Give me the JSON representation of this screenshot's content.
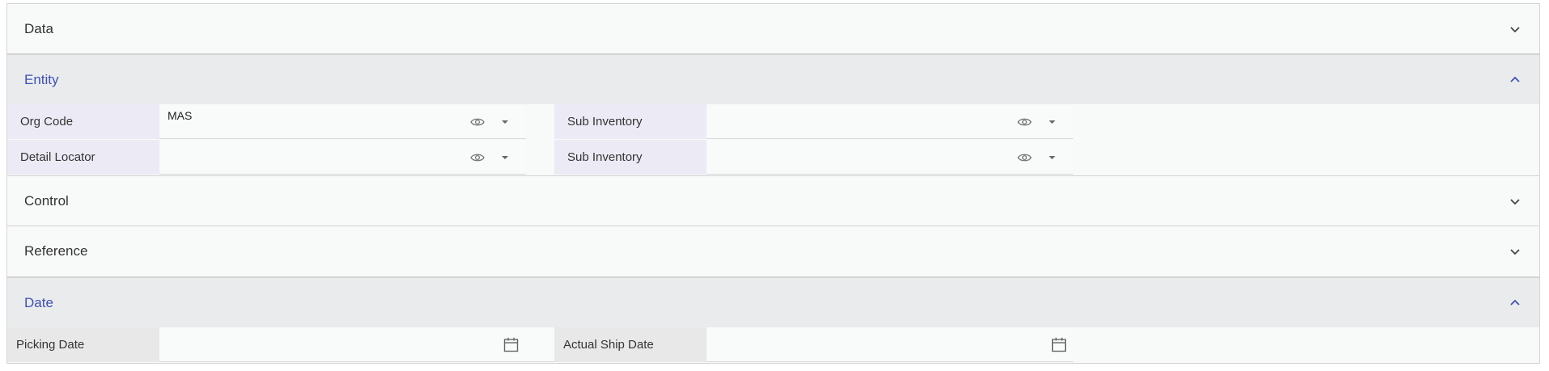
{
  "sections": {
    "data": {
      "title": "Data",
      "state": "collapsed"
    },
    "entity": {
      "title": "Entity",
      "state": "expanded",
      "fields": {
        "org_code": {
          "label": "Org Code",
          "value": "MAS"
        },
        "sub_inventory_1": {
          "label": "Sub Inventory",
          "value": ""
        },
        "detail_locator": {
          "label": "Detail Locator",
          "value": ""
        },
        "sub_inventory_2": {
          "label": "Sub Inventory",
          "value": ""
        }
      }
    },
    "control": {
      "title": "Control",
      "state": "collapsed"
    },
    "reference": {
      "title": "Reference",
      "state": "collapsed"
    },
    "date": {
      "title": "Date",
      "state": "expanded",
      "fields": {
        "picking_date": {
          "label": "Picking Date",
          "value": ""
        },
        "actual_ship_date": {
          "label": "Actual Ship Date",
          "value": ""
        }
      }
    }
  },
  "icons": {
    "expand": "chevron-down-icon",
    "collapse": "chevron-up-icon",
    "view": "eye-icon",
    "dropdown": "caret-down-icon",
    "date": "calendar-icon"
  },
  "colors": {
    "accent": "#3f51b5",
    "label_bg": "#ecebf5",
    "header_open_bg": "#e9ebed"
  }
}
